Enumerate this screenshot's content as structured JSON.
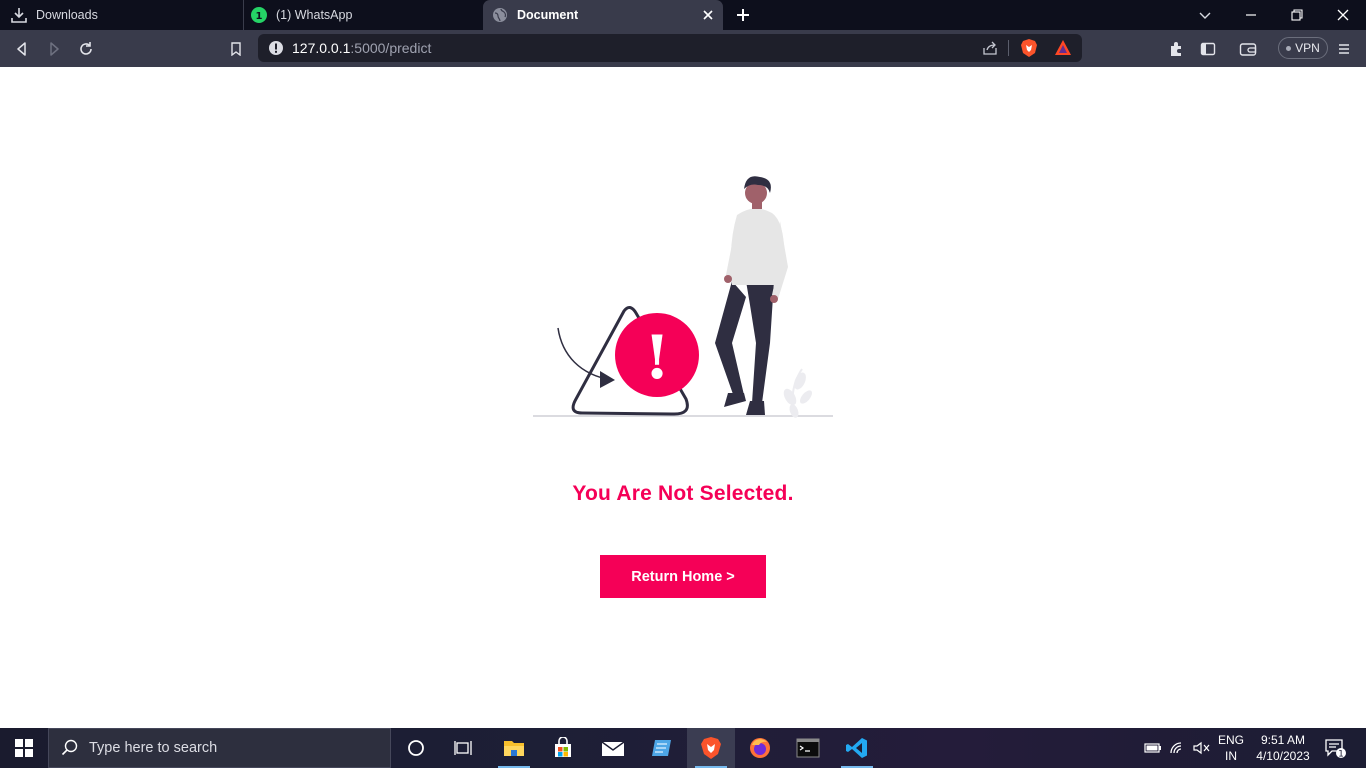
{
  "browser": {
    "tabs": [
      {
        "label": "Downloads",
        "icon": "download-icon"
      },
      {
        "label": "(1) WhatsApp",
        "icon": "whatsapp-icon",
        "badge": "1"
      },
      {
        "label": "Document",
        "icon": "globe-icon",
        "active": true
      }
    ],
    "url": {
      "host": "127.0.0.1",
      "path": ":5000/predict"
    },
    "vpn_label": "VPN"
  },
  "page": {
    "headline": "You Are Not Selected.",
    "button_label": "Return Home >",
    "accent_color": "#f50057",
    "alert_symbol": "!"
  },
  "taskbar": {
    "search_placeholder": "Type here to search",
    "apps": [
      "file-explorer",
      "microsoft-store",
      "mail",
      "notepad-app",
      "brave-browser",
      "firefox",
      "terminal",
      "vs-code"
    ],
    "language": {
      "line1": "ENG",
      "line2": "IN"
    },
    "time": "9:51 AM",
    "date": "4/10/2023",
    "notification_count": "1"
  }
}
